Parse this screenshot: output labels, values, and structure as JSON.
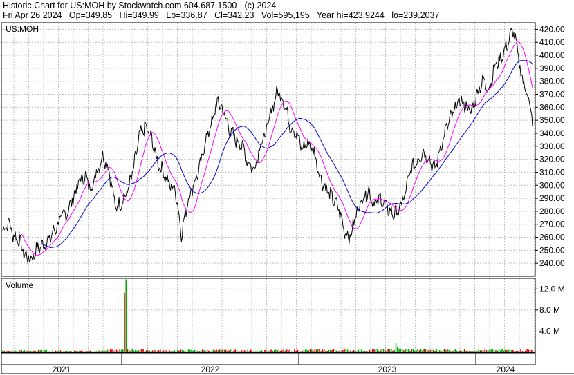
{
  "header": {
    "line1": "Historic Chart for US:MOH by Stockwatch.com 604.687.1500 - (c) 2024",
    "line2": "Fri Apr 26 2024   Op=349.85   Hi=349.99   Lo=336.87   Cl=342.23   Vol=595,195   Year hi=423.9244   lo=239.2037"
  },
  "chart_data": {
    "type": "line",
    "symbol_label": "US:MOH",
    "volume_label": "Volume",
    "price_axis": {
      "ylim": [
        230,
        425
      ],
      "ticks": [
        "420.00",
        "410.00",
        "400.00",
        "390.00",
        "380.00",
        "370.00",
        "360.00",
        "350.00",
        "340.00",
        "330.00",
        "320.00",
        "310.00",
        "300.00",
        "290.00",
        "280.00",
        "270.00",
        "260.00",
        "250.00",
        "240.00"
      ]
    },
    "volume_axis": {
      "ylim": [
        0,
        14
      ],
      "unit": "M",
      "ticks": [
        "12.0 M",
        "8.0 M",
        "4.0 M"
      ]
    },
    "x_axis": {
      "labels": [
        "2021",
        "2022",
        "2023",
        "2024"
      ]
    },
    "colors": {
      "price": "#000000",
      "ma_fast": "#ff00ff",
      "ma_slow": "#0000cc",
      "volume_up": "#00aa00",
      "volume_down": "#dd0000",
      "grid": "#c0c0c0"
    },
    "price_waypoints": [
      [
        0,
        265
      ],
      [
        3,
        272
      ],
      [
        5,
        262
      ],
      [
        8,
        258
      ],
      [
        11,
        246
      ],
      [
        14,
        243
      ],
      [
        17,
        251
      ],
      [
        20,
        254
      ],
      [
        23,
        258
      ],
      [
        26,
        266
      ],
      [
        29,
        275
      ],
      [
        32,
        279
      ],
      [
        35,
        290
      ],
      [
        38,
        303
      ],
      [
        41,
        307
      ],
      [
        44,
        297
      ],
      [
        47,
        312
      ],
      [
        50,
        323
      ],
      [
        53,
        311
      ],
      [
        56,
        283
      ],
      [
        59,
        287
      ],
      [
        62,
        295
      ],
      [
        65,
        312
      ],
      [
        68,
        338
      ],
      [
        71,
        345
      ],
      [
        74,
        336
      ],
      [
        77,
        318
      ],
      [
        80,
        310
      ],
      [
        83,
        300
      ],
      [
        86,
        296
      ],
      [
        89,
        262
      ],
      [
        92,
        288
      ],
      [
        95,
        301
      ],
      [
        98,
        313
      ],
      [
        101,
        335
      ],
      [
        104,
        348
      ],
      [
        107,
        365
      ],
      [
        110,
        356
      ],
      [
        113,
        342
      ],
      [
        116,
        335
      ],
      [
        119,
        331
      ],
      [
        122,
        318
      ],
      [
        125,
        312
      ],
      [
        128,
        330
      ],
      [
        131,
        340
      ],
      [
        134,
        360
      ],
      [
        137,
        373
      ],
      [
        140,
        364
      ],
      [
        143,
        346
      ],
      [
        146,
        340
      ],
      [
        149,
        328
      ],
      [
        152,
        333
      ],
      [
        155,
        325
      ],
      [
        158,
        306
      ],
      [
        161,
        297
      ],
      [
        164,
        290
      ],
      [
        167,
        283
      ],
      [
        170,
        265
      ],
      [
        173,
        260
      ],
      [
        176,
        279
      ],
      [
        179,
        290
      ],
      [
        182,
        296
      ],
      [
        185,
        285
      ],
      [
        188,
        290
      ],
      [
        191,
        283
      ],
      [
        194,
        278
      ],
      [
        197,
        280
      ],
      [
        200,
        292
      ],
      [
        203,
        312
      ],
      [
        206,
        318
      ],
      [
        209,
        326
      ],
      [
        212,
        321
      ],
      [
        215,
        312
      ],
      [
        218,
        330
      ],
      [
        221,
        345
      ],
      [
        224,
        355
      ],
      [
        227,
        365
      ],
      [
        230,
        362
      ],
      [
        233,
        356
      ],
      [
        236,
        371
      ],
      [
        239,
        381
      ],
      [
        242,
        374
      ],
      [
        245,
        392
      ],
      [
        248,
        398
      ],
      [
        251,
        408
      ],
      [
        254,
        420
      ],
      [
        256,
        404
      ],
      [
        258,
        385
      ],
      [
        260,
        375
      ],
      [
        262,
        365
      ],
      [
        264,
        342
      ]
    ],
    "volume_waypoints": [
      [
        0,
        0.25
      ],
      [
        20,
        0.3
      ],
      [
        40,
        0.25
      ],
      [
        55,
        0.35
      ],
      [
        60,
        0.4
      ],
      [
        61,
        13.8
      ],
      [
        62,
        0.5
      ],
      [
        80,
        0.3
      ],
      [
        100,
        0.35
      ],
      [
        130,
        0.3
      ],
      [
        160,
        0.4
      ],
      [
        180,
        0.35
      ],
      [
        195,
        0.5
      ],
      [
        196,
        1.8
      ],
      [
        197,
        0.5
      ],
      [
        220,
        0.4
      ],
      [
        240,
        0.35
      ],
      [
        264,
        0.4
      ]
    ]
  }
}
